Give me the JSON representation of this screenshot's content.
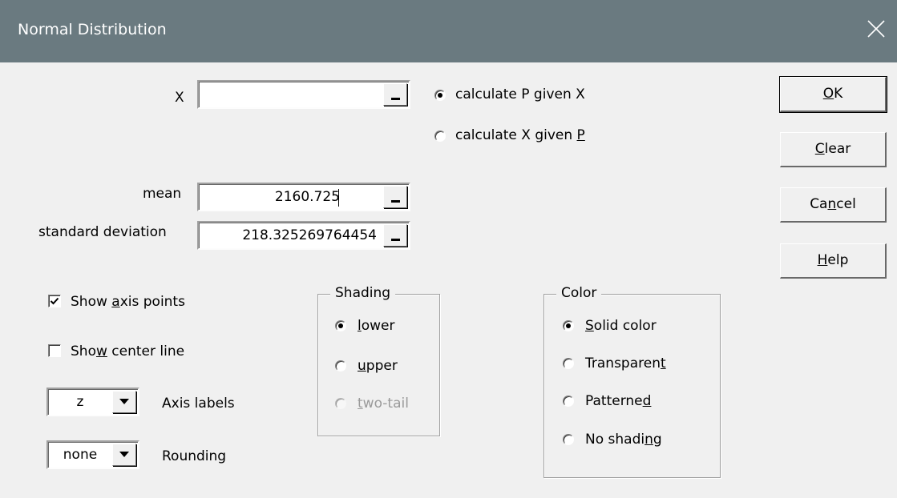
{
  "window": {
    "title": "Normal Distribution"
  },
  "x_field": {
    "label": "X",
    "value": ""
  },
  "calc_mode": {
    "option1": {
      "text": "calculate P given X",
      "selected": true
    },
    "option2": {
      "text_before": "calculate X given ",
      "mnemonic": "P",
      "selected": false
    }
  },
  "mean": {
    "label": "mean",
    "value": "2160.725"
  },
  "std_dev": {
    "label": "standard deviation",
    "value": "218.325269764454"
  },
  "buttons": {
    "ok": {
      "mn": "O",
      "rest": "K"
    },
    "clear": {
      "mn": "C",
      "rest": "lear"
    },
    "cancel": {
      "pre": "Ca",
      "mn": "n",
      "post": "cel"
    },
    "help": {
      "mn": "H",
      "rest": "elp"
    }
  },
  "show_axis_points": {
    "pre": "Show ",
    "mn": "a",
    "post": "xis points",
    "checked": true
  },
  "show_center_line": {
    "pre": "Sho",
    "mn": "w",
    "post": " center line",
    "checked": false
  },
  "axis_labels": {
    "value": "z",
    "label": "Axis labels"
  },
  "rounding": {
    "value": "none",
    "label": "Rounding"
  },
  "shading": {
    "title": "Shading",
    "lower": {
      "mn": "l",
      "rest": "ower",
      "selected": true
    },
    "upper": {
      "mn": "u",
      "rest": "pper",
      "selected": false
    },
    "two_tail": {
      "mn": "t",
      "rest": "wo-tail",
      "selected": false,
      "disabled": true
    }
  },
  "color": {
    "title": "Color",
    "solid": {
      "mn": "S",
      "rest": "olid color",
      "selected": true
    },
    "transparent": {
      "pre": "Transparen",
      "mn": "t",
      "selected": false
    },
    "patterned": {
      "pre": "Patterne",
      "mn": "d",
      "selected": false
    },
    "no_shading": {
      "pre": "No shadi",
      "mn": "n",
      "post": "g",
      "selected": false
    }
  },
  "colors": {
    "titlebar": "#6a7a80",
    "dialog_bg": "#f0f0f0"
  }
}
